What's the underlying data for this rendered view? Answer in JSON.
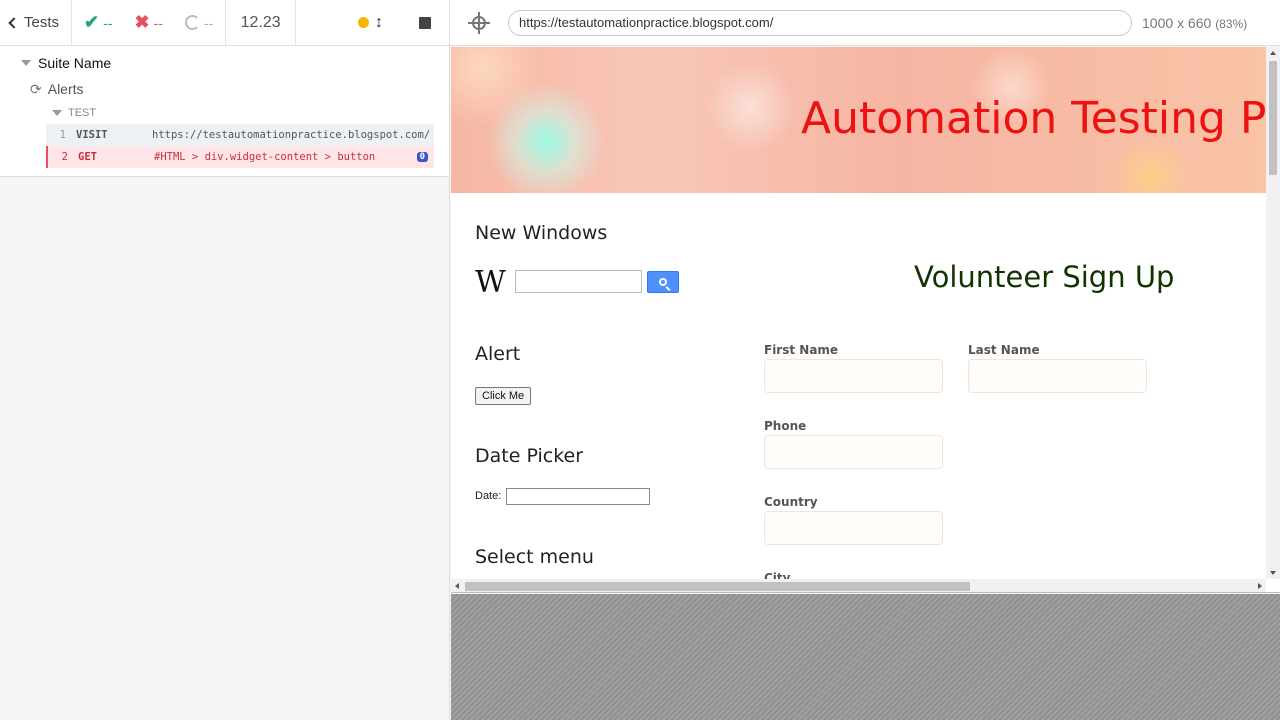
{
  "reporter": {
    "tests_label": "Tests",
    "passed": "--",
    "failed": "--",
    "pending": "--",
    "duration": "12.23",
    "suite_name": "Suite Name",
    "test_name": "Alerts",
    "group_label": "TEST",
    "commands": [
      {
        "num": "1",
        "name": "VISIT",
        "message": "https://testautomationpractice.blogspot.com/"
      },
      {
        "num": "2",
        "name": "GET",
        "message": "#HTML > div.widget-content > button",
        "badge": "0"
      }
    ]
  },
  "aut": {
    "url": "https://testautomationpractice.blogspot.com/",
    "viewport": "1000 x 660",
    "scale": "(83%)"
  },
  "page": {
    "title": "Automation Testing Practice",
    "new_windows_heading": "New Windows",
    "wiki_logo": "W",
    "volunteer_title": "Volunteer Sign Up",
    "alert_heading": "Alert",
    "click_me": "Click Me",
    "date_picker_heading": "Date Picker",
    "date_label": "Date:",
    "select_menu_heading": "Select menu",
    "form": {
      "first_name": "First Name",
      "last_name": "Last Name",
      "phone": "Phone",
      "country": "Country",
      "city": "City"
    }
  },
  "colors": {
    "pass": "#1fa971",
    "fail": "#e94f5f",
    "running": "#f7b500",
    "title_red": "#ee1111",
    "volunteer_green": "#113300"
  },
  "icons": [
    "chevron-left-icon",
    "check-icon",
    "x-icon",
    "pending-circle-icon",
    "status-dot-icon",
    "resize-arrows-icon",
    "stop-icon",
    "triangle-down-icon",
    "refresh-icon",
    "crosshair-icon",
    "search-icon"
  ]
}
